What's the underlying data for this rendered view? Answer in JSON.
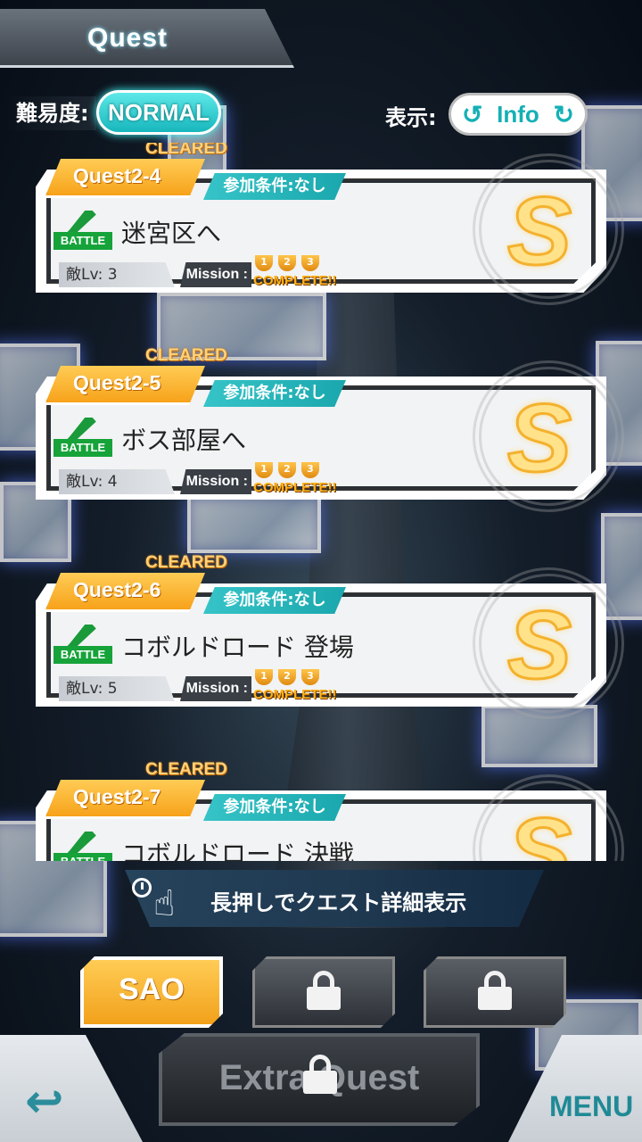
{
  "header": {
    "title": "Quest"
  },
  "difficulty": {
    "label": "難易度:",
    "value": "NORMAL"
  },
  "view": {
    "label": "表示:",
    "value": "Info"
  },
  "quests": [
    {
      "cleared": "CLEARED",
      "id": "Quest2-4",
      "condition": "参加条件:なし",
      "type": "BATTLE",
      "name": "迷宮区へ",
      "level": "敵Lv: 3",
      "mission_label": "Mission :",
      "trophies": [
        "1",
        "2",
        "3"
      ],
      "mission_status": "COMPLETE!!",
      "rank": "S"
    },
    {
      "cleared": "CLEARED",
      "id": "Quest2-5",
      "condition": "参加条件:なし",
      "type": "BATTLE",
      "name": "ボス部屋へ",
      "level": "敵Lv: 4",
      "mission_label": "Mission :",
      "trophies": [
        "1",
        "2",
        "3"
      ],
      "mission_status": "COMPLETE!!",
      "rank": "S"
    },
    {
      "cleared": "CLEARED",
      "id": "Quest2-6",
      "condition": "参加条件:なし",
      "type": "BATTLE",
      "name": "コボルドロード 登場",
      "level": "敵Lv: 5",
      "mission_label": "Mission :",
      "trophies": [
        "1",
        "2",
        "3"
      ],
      "mission_status": "COMPLETE!!",
      "rank": "S"
    },
    {
      "cleared": "CLEARED",
      "id": "Quest2-7",
      "condition": "参加条件:なし",
      "type": "BATTLE",
      "name": "コボルドロード 決戦",
      "level": "",
      "mission_label": "",
      "trophies": [],
      "mission_status": "",
      "rank": "S"
    }
  ],
  "hint": {
    "text": "長押しでクエスト詳細表示"
  },
  "tabs": [
    {
      "label": "SAO",
      "locked": false
    },
    {
      "label": "",
      "locked": true
    },
    {
      "label": "",
      "locked": true
    }
  ],
  "extra": {
    "label": "Extra Quest",
    "locked": true
  },
  "menu": {
    "label": "MENU"
  },
  "colors": {
    "accent_orange": "#f7a21a",
    "accent_teal": "#1aa7ad",
    "battle_green": "#16a33a"
  }
}
